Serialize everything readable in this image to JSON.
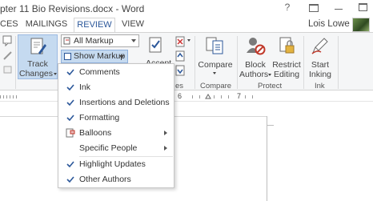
{
  "window": {
    "title": "pter 11 Bio Revisions.docx - Word",
    "help_label": "?"
  },
  "tabs": [
    {
      "label": "CES"
    },
    {
      "label": "MAILINGS"
    },
    {
      "label": "REVIEW"
    },
    {
      "label": "VIEW"
    }
  ],
  "user": {
    "name": "Lois Lowe"
  },
  "ribbon": {
    "tracking": {
      "track_changes_label_1": "Track",
      "track_changes_label_2": "Changes",
      "markup_dropdown_value": "All Markup",
      "show_markup_label": "Show Markup"
    },
    "accept_label": "Accept",
    "changes_group_fragment": "es",
    "compare": {
      "label": "Compare",
      "group": "Compare"
    },
    "protect": {
      "block_authors_1": "Block",
      "block_authors_2": "Authors",
      "restrict_editing_1": "Restrict",
      "restrict_editing_2": "Editing",
      "group": "Protect"
    },
    "ink": {
      "start_inking_1": "Start",
      "start_inking_2": "Inking",
      "group": "Ink"
    }
  },
  "ruler": {
    "numbers": [
      "6",
      "7"
    ]
  },
  "menu": {
    "items": [
      {
        "label": "Comments",
        "checked": true,
        "submenu": false
      },
      {
        "label": "Ink",
        "checked": true,
        "submenu": false
      },
      {
        "label": "Insertions and Deletions",
        "checked": true,
        "submenu": false
      },
      {
        "label": "Formatting",
        "checked": true,
        "submenu": false
      },
      {
        "label": "Balloons",
        "checked": false,
        "submenu": true
      },
      {
        "label": "Specific People",
        "checked": false,
        "submenu": true
      },
      {
        "label": "Highlight Updates",
        "checked": true,
        "submenu": false
      },
      {
        "label": "Other Authors",
        "checked": true,
        "submenu": false
      }
    ]
  },
  "colors": {
    "accent": "#2b579a",
    "pressed": "#c5daf0",
    "check": "#2b579a"
  }
}
